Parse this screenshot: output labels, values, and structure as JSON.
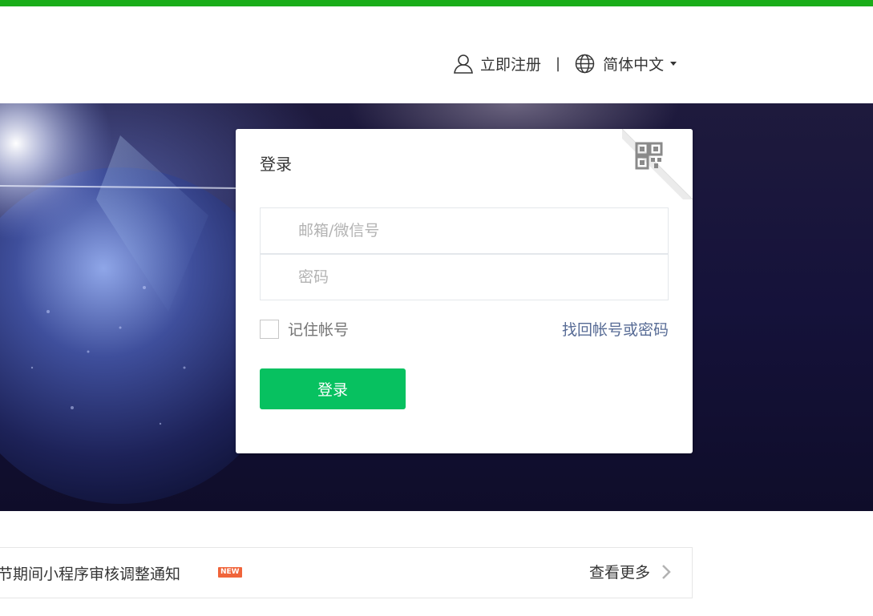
{
  "header": {
    "register_label": "立即注册",
    "separator": "|",
    "language_label": "简体中文",
    "icons": [
      "user-icon",
      "globe-icon",
      "caret-down-icon"
    ]
  },
  "login_card": {
    "title": "登录",
    "qr_icon": "qr-code-icon",
    "account_placeholder": "邮箱/微信号",
    "account_value": "",
    "password_placeholder": "密码",
    "password_value": "",
    "remember_label": "记住帐号",
    "remember_checked": false,
    "forgot_label": "找回帐号或密码",
    "login_button_label": "登录"
  },
  "notice": {
    "text": "节期间小程序审核调整通知",
    "badge": "NEW",
    "more_label": "查看更多"
  },
  "colors": {
    "brand_green": "#1aad19",
    "button_green": "#07c160",
    "link_blue": "#576b95",
    "badge_orange": "#f0643a",
    "banner_dark": "#15123a"
  }
}
